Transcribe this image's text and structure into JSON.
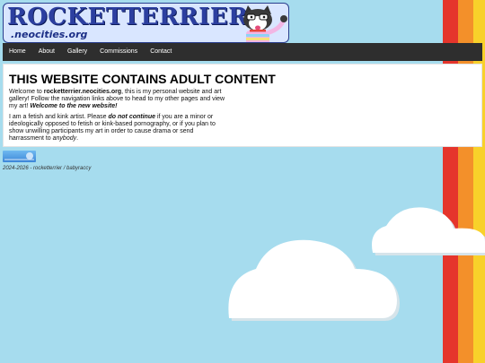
{
  "banner": {
    "title": "ROCKETTERRIER",
    "subtitle": ".neocities.org",
    "mascot_icon": "husky-mascot"
  },
  "nav": {
    "items": [
      {
        "label": "Home"
      },
      {
        "label": "About"
      },
      {
        "label": "Gallery"
      },
      {
        "label": "Commissions"
      },
      {
        "label": "Contact"
      }
    ]
  },
  "content": {
    "heading": "THIS WEBSITE CONTAINS ADULT CONTENT",
    "p1_a": "Welcome to ",
    "p1_site": "rocketterrier.neocities.org",
    "p1_b": ", this is my personal website and art gallery! Follow the navigation links above to head to my other pages and view my art! ",
    "p1_welcome": "Welcome to the new website!",
    "p2_a": "I am a fetish and kink artist. Please ",
    "p2_dnc": "do not continue",
    "p2_b": " if you are a minor or ideologically opposed to fetish or kink-based pornography, or if you plan to show unwilling participants my art in order to cause drama or send harrassment to ",
    "p2_anybody": "anybody",
    "p2_end": "."
  },
  "footer": {
    "text": "2024-2026 - rocketterrier / babyraccy"
  },
  "colors": {
    "background": "#a6dcee",
    "stripe_red": "#e5352c",
    "stripe_orange": "#f3902a",
    "stripe_yellow": "#f8d12a",
    "nav_bg": "#2e2e2e",
    "banner_text": "#2c3fa0"
  }
}
